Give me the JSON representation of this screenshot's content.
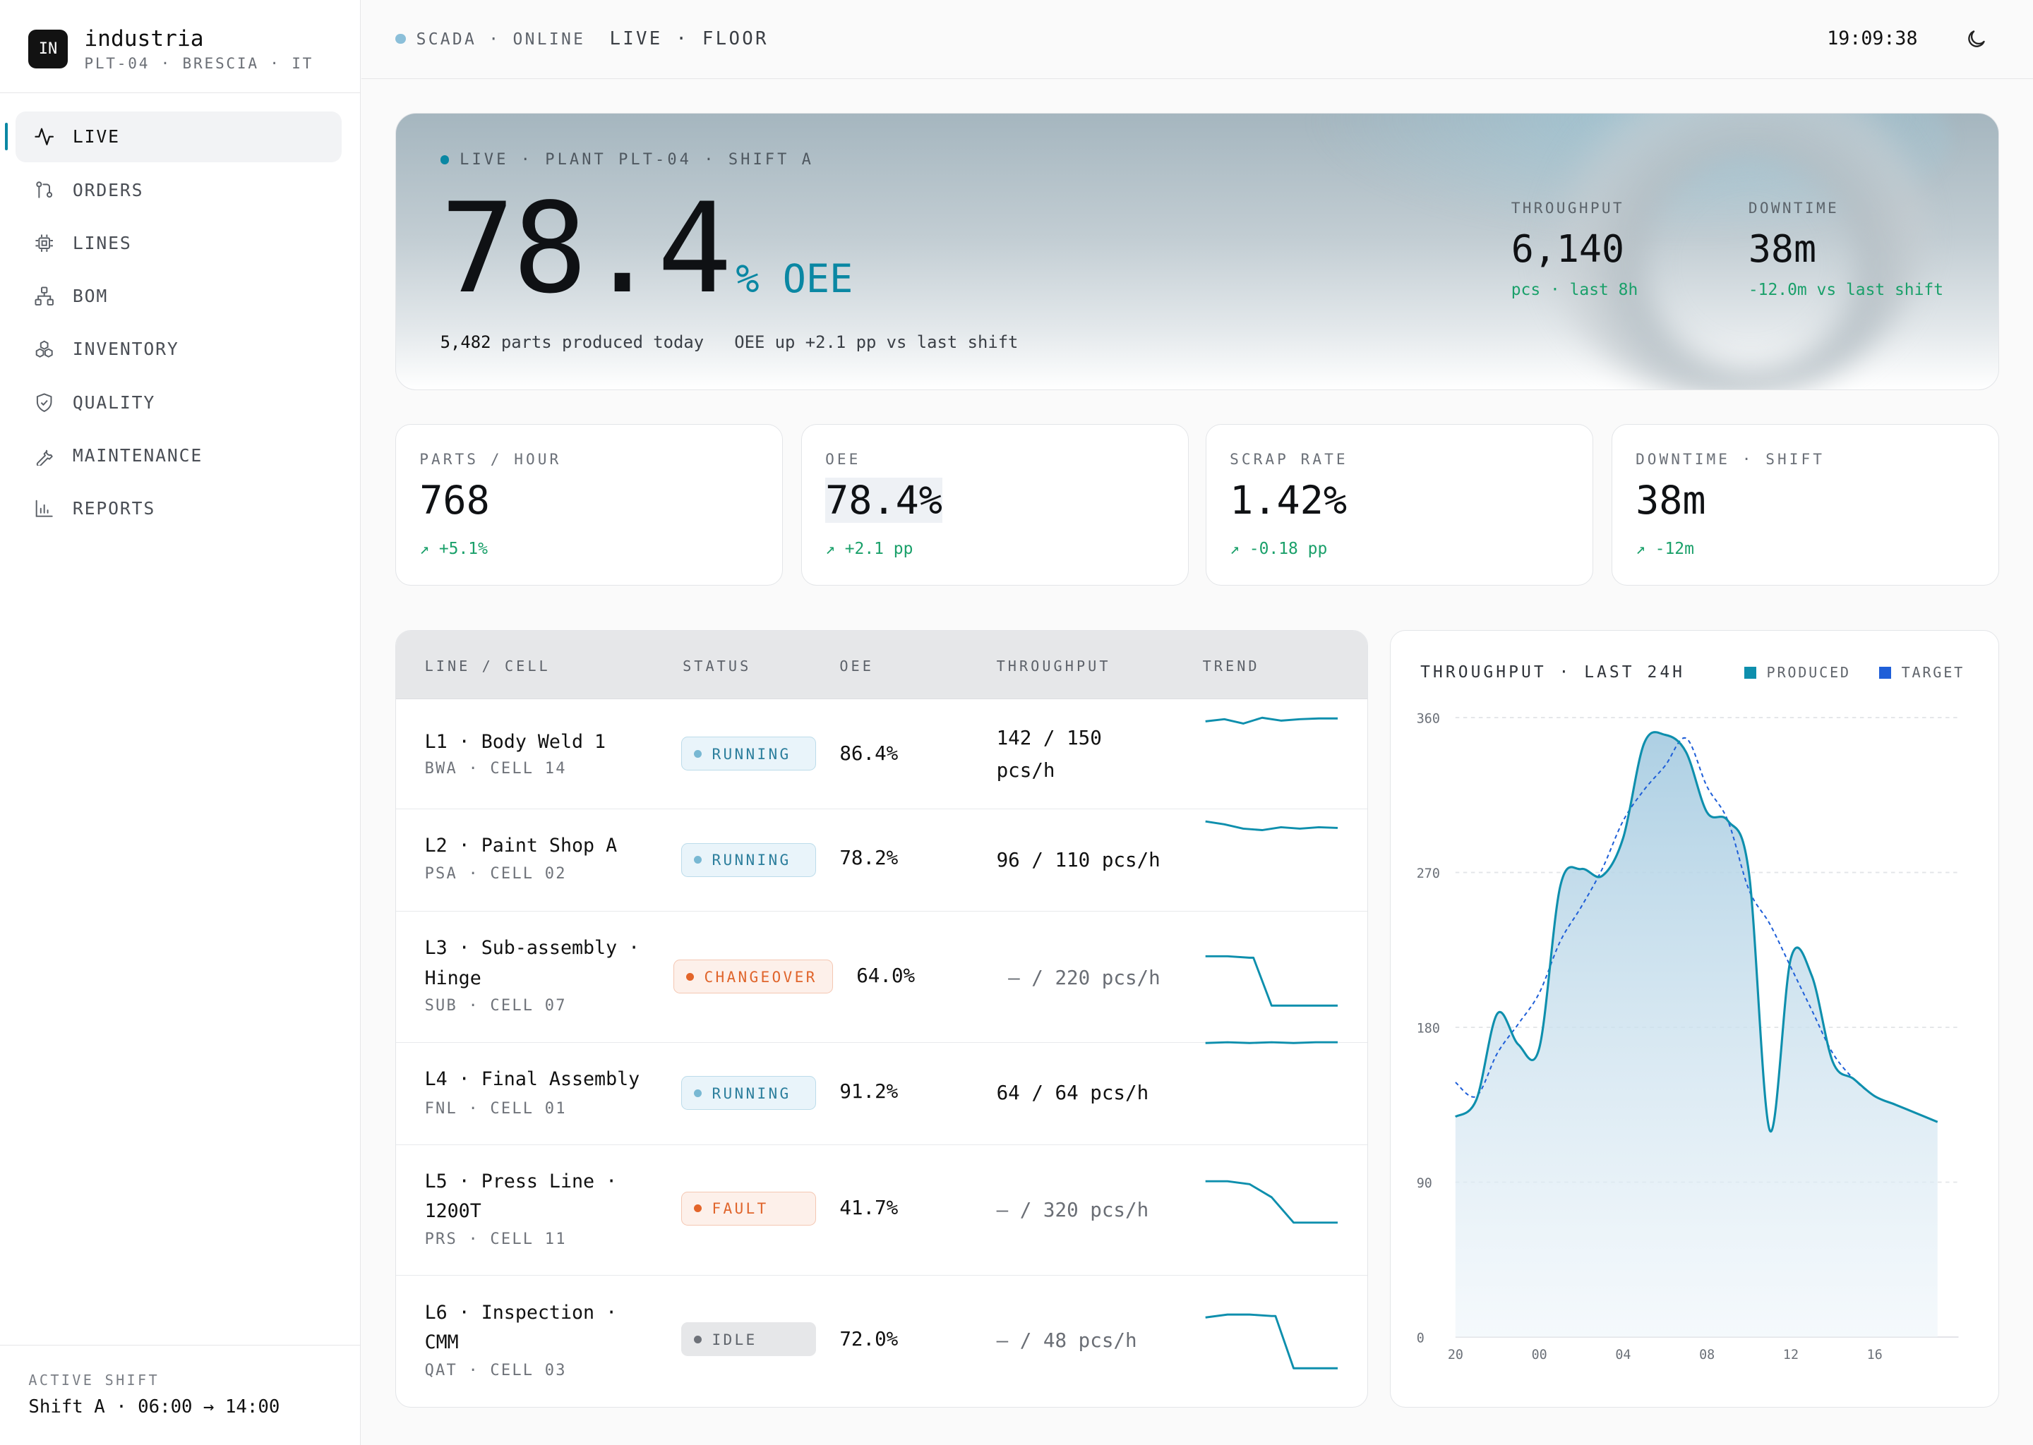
{
  "brand": {
    "logo": "IN",
    "name": "industria",
    "sub": "PLT-04 · BRESCIA · IT"
  },
  "nav": [
    {
      "label": "LIVE",
      "icon": "activity-icon",
      "active": true
    },
    {
      "label": "ORDERS",
      "icon": "git-pull-request-icon"
    },
    {
      "label": "LINES",
      "icon": "cpu-chip-icon"
    },
    {
      "label": "BOM",
      "icon": "hierarchy-icon"
    },
    {
      "label": "INVENTORY",
      "icon": "boxes-icon"
    },
    {
      "label": "QUALITY",
      "icon": "shield-check-icon"
    },
    {
      "label": "MAINTENANCE",
      "icon": "wrench-icon"
    },
    {
      "label": "REPORTS",
      "icon": "bar-chart-icon"
    }
  ],
  "shift": {
    "label": "ACTIVE SHIFT",
    "value": "Shift A · 06:00 → 14:00"
  },
  "topbar": {
    "status": "SCADA · ONLINE",
    "mode": "LIVE · FLOOR",
    "clock": "19:09:38",
    "theme_icon": "moon-icon"
  },
  "hero": {
    "tag": "LIVE · PLANT PLT-04 · SHIFT A",
    "value": "78.4",
    "unit": "% OEE",
    "parts_count": "5,482",
    "parts_text": "parts produced today",
    "oee_note": "OEE up +2.1 pp vs last shift",
    "kpis": [
      {
        "label": "THROUGHPUT",
        "value": "6,140",
        "sub": "pcs · last 8h"
      },
      {
        "label": "DOWNTIME",
        "value": "38m",
        "sub": "-12.0m vs last shift"
      }
    ]
  },
  "cards": [
    {
      "label": "PARTS / HOUR",
      "value": "768",
      "delta": "↗  +5.1%"
    },
    {
      "label": "OEE",
      "value": "78.4%",
      "delta": "↗  +2.1 pp"
    },
    {
      "label": "SCRAP RATE",
      "value": "1.42%",
      "delta": "↗  -0.18 pp"
    },
    {
      "label": "DOWNTIME · SHIFT",
      "value": "38m",
      "delta": "↗  -12m"
    }
  ],
  "table": {
    "headers": [
      "LINE / CELL",
      "STATUS",
      "OEE",
      "THROUGHPUT",
      "TREND"
    ],
    "rows": [
      {
        "name": "L1 · Body Weld 1",
        "code": "BWA · CELL 14",
        "status": "RUNNING",
        "oee": "86.4%",
        "throughput": "142 / 150 pcs/h",
        "trend": [
          0.75,
          0.78,
          0.72,
          0.8,
          0.76,
          0.78,
          0.79,
          0.79
        ]
      },
      {
        "name": "L2 · Paint Shop A",
        "code": "PSA · CELL 02",
        "status": "RUNNING",
        "oee": "78.2%",
        "throughput": "96 / 110 pcs/h",
        "trend": [
          0.82,
          0.78,
          0.72,
          0.7,
          0.74,
          0.72,
          0.74,
          0.73
        ]
      },
      {
        "name": "L3 · Sub-assembly · Hinge",
        "code": "SUB · CELL 07",
        "status": "CHANGEOVER",
        "oee": "64.0%",
        "throughput": "— / 220 pcs/h",
        "trend": [
          0.78,
          0.78,
          0.76,
          0.1,
          0.1,
          0.1,
          0.1
        ]
      },
      {
        "name": "L4 · Final Assembly",
        "code": "FNL · CELL 01",
        "status": "RUNNING",
        "oee": "91.2%",
        "throughput": "64 / 64 pcs/h",
        "trend": [
          0.8,
          0.81,
          0.8,
          0.81,
          0.8,
          0.81,
          0.81
        ]
      },
      {
        "name": "L5 · Press Line · 1200T",
        "code": "PRS · CELL 11",
        "status": "FAULT",
        "oee": "41.7%",
        "throughput": "— / 320 pcs/h",
        "trend": [
          0.82,
          0.82,
          0.78,
          0.6,
          0.25,
          0.25,
          0.25
        ]
      },
      {
        "name": "L6 · Inspection · CMM",
        "code": "QAT · CELL 03",
        "status": "IDLE",
        "oee": "72.0%",
        "throughput": "— / 48 pcs/h",
        "trend": [
          0.8,
          0.84,
          0.84,
          0.82,
          0.1,
          0.1,
          0.1
        ]
      }
    ]
  },
  "chart_data": {
    "type": "area",
    "title": "THROUGHPUT · LAST 24H",
    "x_ticks": [
      "20",
      "00",
      "04",
      "08",
      "12",
      "16"
    ],
    "y_ticks": [
      0,
      90,
      180,
      270,
      360
    ],
    "ylim": [
      0,
      360
    ],
    "x_hours": [
      20,
      21,
      22,
      23,
      24,
      25,
      26,
      27,
      28,
      29,
      30,
      31,
      32,
      33,
      34,
      35,
      36,
      37,
      38,
      39,
      40,
      41,
      42,
      43
    ],
    "series": [
      {
        "name": "PRODUCED",
        "color": "#0e8fad",
        "values": [
          128,
          138,
          188,
          170,
          168,
          262,
          272,
          268,
          290,
          345,
          350,
          340,
          305,
          300,
          270,
          120,
          220,
          210,
          160,
          150,
          140,
          135,
          130,
          125
        ]
      },
      {
        "name": "TARGET",
        "color": "#1f5fd8",
        "values": [
          148,
          140,
          165,
          182,
          200,
          230,
          250,
          272,
          300,
          318,
          332,
          348,
          320,
          300,
          260,
          240,
          215,
          190,
          165,
          150,
          140,
          135,
          130,
          125
        ]
      }
    ],
    "legend": "top-right",
    "grid": true
  }
}
